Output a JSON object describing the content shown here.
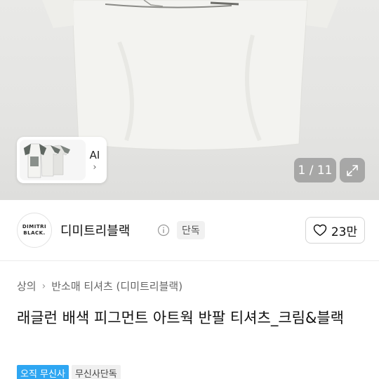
{
  "gallery": {
    "counter": "1 / 11",
    "ai_label": "AI",
    "chevron": "›"
  },
  "brand": {
    "logo_line1": "DIMITRI",
    "logo_line2": "BLACK.",
    "name": "디미트리블랙",
    "exclusive": "단독",
    "likes": "23만"
  },
  "breadcrumb": [
    "상의",
    "반소매 티셔츠 (디미트리블랙)"
  ],
  "breadcrumb_sep": "›",
  "product": {
    "title": "래글런 배색 피그먼트 아트웍 반팔 티셔츠_크림&블랙"
  },
  "badges": [
    "오직 무신사",
    "무신사단독"
  ],
  "icons": [
    "info-icon",
    "heart-icon",
    "expand-icon",
    "chevron-right-icon"
  ],
  "colors": {
    "accent_blue": "#2ea6f2",
    "hero_bg": "#e6e6e4",
    "shirt": "#f2f2ef"
  }
}
